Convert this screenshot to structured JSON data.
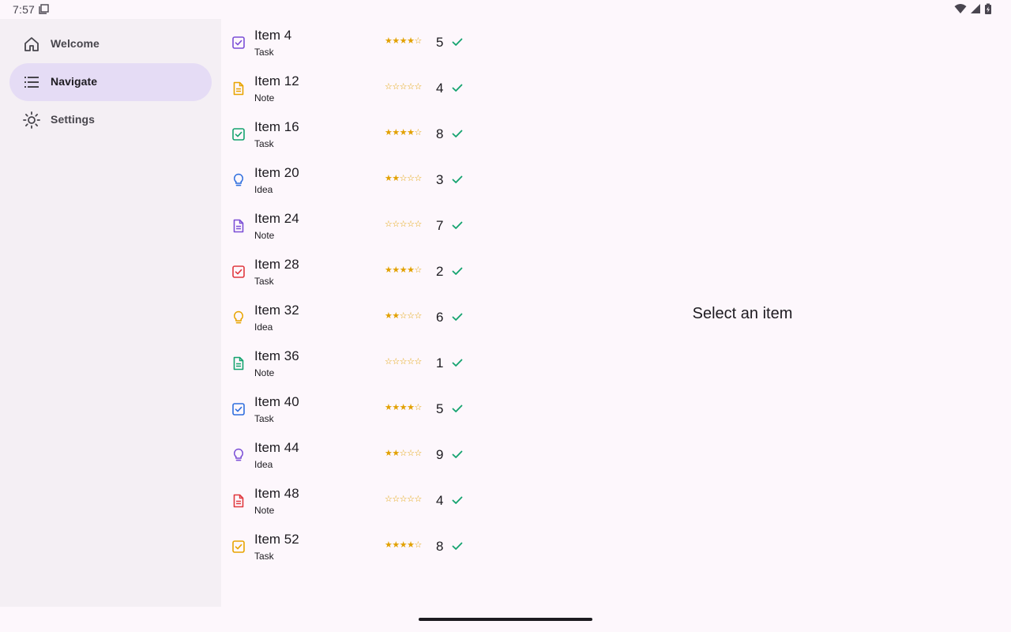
{
  "status": {
    "time": "7:57"
  },
  "nav": {
    "items": [
      {
        "label": "Welcome",
        "icon": "home-icon",
        "active": false
      },
      {
        "label": "Navigate",
        "icon": "list-icon",
        "active": true
      },
      {
        "label": "Settings",
        "icon": "brightness-icon",
        "active": false
      }
    ]
  },
  "list": {
    "items": [
      {
        "title": "Item 4",
        "subtitle": "Task",
        "type": "task",
        "color": "#7b4fd6",
        "stars": "★★★★☆",
        "count": "5"
      },
      {
        "title": "Item 12",
        "subtitle": "Note",
        "type": "note",
        "color": "#e8a400",
        "stars": "☆☆☆☆☆",
        "count": "4"
      },
      {
        "title": "Item 16",
        "subtitle": "Task",
        "type": "task",
        "color": "#14a36f",
        "stars": "★★★★☆",
        "count": "8"
      },
      {
        "title": "Item 20",
        "subtitle": "Idea",
        "type": "idea",
        "color": "#2f6fde",
        "stars": "★★☆☆☆",
        "count": "3"
      },
      {
        "title": "Item 24",
        "subtitle": "Note",
        "type": "note",
        "color": "#7b4fd6",
        "stars": "☆☆☆☆☆",
        "count": "7"
      },
      {
        "title": "Item 28",
        "subtitle": "Task",
        "type": "task",
        "color": "#e0383e",
        "stars": "★★★★☆",
        "count": "2"
      },
      {
        "title": "Item 32",
        "subtitle": "Idea",
        "type": "idea",
        "color": "#e8a400",
        "stars": "★★☆☆☆",
        "count": "6"
      },
      {
        "title": "Item 36",
        "subtitle": "Note",
        "type": "note",
        "color": "#14a36f",
        "stars": "☆☆☆☆☆",
        "count": "1"
      },
      {
        "title": "Item 40",
        "subtitle": "Task",
        "type": "task",
        "color": "#2f6fde",
        "stars": "★★★★☆",
        "count": "5"
      },
      {
        "title": "Item 44",
        "subtitle": "Idea",
        "type": "idea",
        "color": "#7b4fd6",
        "stars": "★★☆☆☆",
        "count": "9"
      },
      {
        "title": "Item 48",
        "subtitle": "Note",
        "type": "note",
        "color": "#e0383e",
        "stars": "☆☆☆☆☆",
        "count": "4"
      },
      {
        "title": "Item 52",
        "subtitle": "Task",
        "type": "task",
        "color": "#e8a400",
        "stars": "★★★★☆",
        "count": "8"
      }
    ],
    "check_color": "#14a36f",
    "star_color": "#e2a100"
  },
  "detail": {
    "placeholder": "Select an item"
  }
}
